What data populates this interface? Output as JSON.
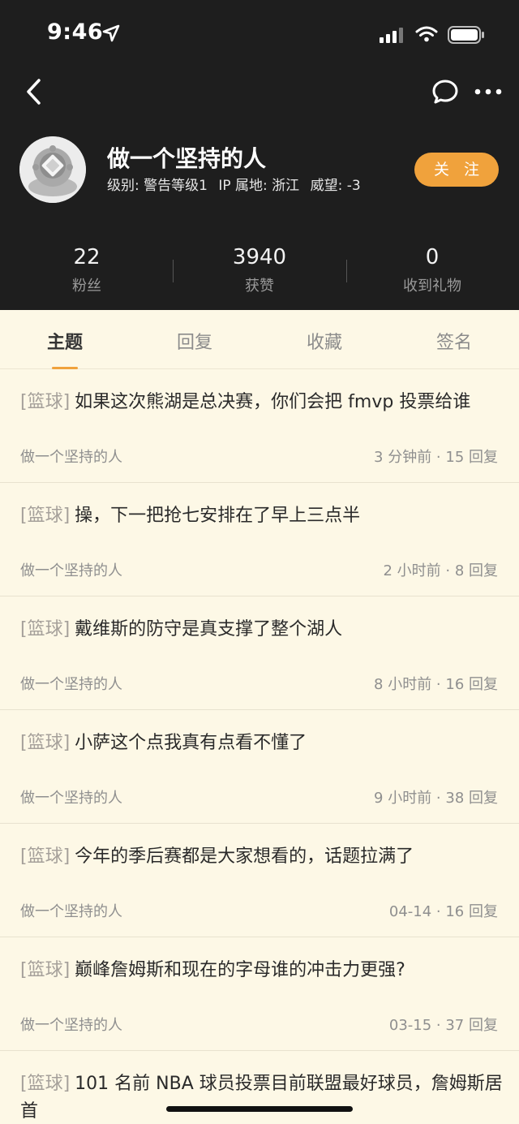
{
  "status_bar": {
    "time": "9:46"
  },
  "profile": {
    "username": "做一个坚持的人",
    "level": "级别: 警告等级1",
    "ip": "IP 属地: 浙江",
    "prestige": "威望: -3",
    "follow_label": "关 注"
  },
  "stats": [
    {
      "value": "22",
      "label": "粉丝"
    },
    {
      "value": "3940",
      "label": "获赞"
    },
    {
      "value": "0",
      "label": "收到礼物"
    }
  ],
  "tabs": [
    {
      "label": "主题",
      "active": true
    },
    {
      "label": "回复",
      "active": false
    },
    {
      "label": "收藏",
      "active": false
    },
    {
      "label": "签名",
      "active": false
    }
  ],
  "posts": [
    {
      "tag": "[篮球]",
      "title": "如果这次熊湖是总决赛，你们会把 fmvp 投票给谁",
      "author": "做一个坚持的人",
      "info": "3 分钟前 · 15 回复"
    },
    {
      "tag": "[篮球]",
      "title": "操，下一把抢七安排在了早上三点半",
      "author": "做一个坚持的人",
      "info": "2 小时前 · 8 回复"
    },
    {
      "tag": "[篮球]",
      "title": "戴维斯的防守是真支撑了整个湖人",
      "author": "做一个坚持的人",
      "info": "8 小时前 · 16 回复"
    },
    {
      "tag": "[篮球]",
      "title": "小萨这个点我真有点看不懂了",
      "author": "做一个坚持的人",
      "info": "9 小时前 · 38 回复"
    },
    {
      "tag": "[篮球]",
      "title": "今年的季后赛都是大家想看的，话题拉满了",
      "author": "做一个坚持的人",
      "info": "04-14 · 16 回复"
    },
    {
      "tag": "[篮球]",
      "title": "巅峰詹姆斯和现在的字母谁的冲击力更强?",
      "author": "做一个坚持的人",
      "info": "03-15 · 37 回复"
    },
    {
      "tag": "[篮球]",
      "title": "101 名前 NBA 球员投票目前联盟最好球员，詹姆斯居首",
      "author": "",
      "info": ""
    }
  ],
  "colors": {
    "header_bg": "#1e1e1e",
    "accent": "#f0a23c",
    "content_bg": "#fdf8e6"
  },
  "icons": [
    "location-arrow-icon",
    "signal-icon",
    "wifi-icon",
    "battery-icon",
    "back-arrow-icon",
    "chat-bubble-icon",
    "more-dots-icon",
    "diving-helmet-avatar"
  ]
}
